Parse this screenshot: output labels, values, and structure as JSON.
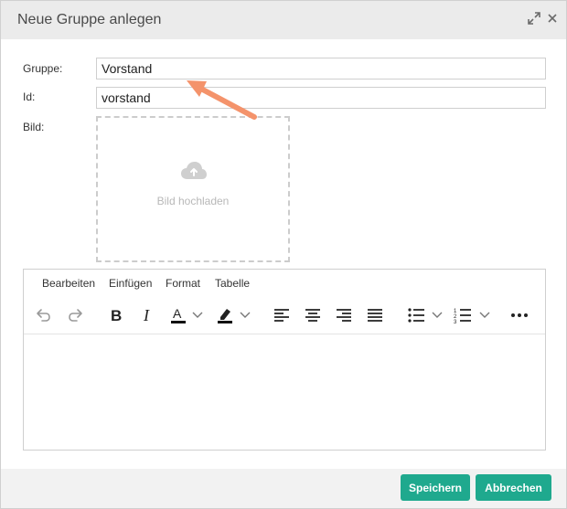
{
  "dialog": {
    "title": "Neue Gruppe anlegen",
    "icons": {
      "maximize": "expand-arrows-icon",
      "close": "close-icon"
    }
  },
  "form": {
    "gruppe": {
      "label": "Gruppe:",
      "value": "Vorstand"
    },
    "id": {
      "label": "Id:",
      "value": "vorstand"
    },
    "bild": {
      "label": "Bild:",
      "upload_text": "Bild hochladen",
      "icon": "cloud-upload-icon"
    }
  },
  "editor": {
    "menu": [
      "Bearbeiten",
      "Einfügen",
      "Format",
      "Tabelle"
    ],
    "toolbar": [
      "undo-icon",
      "redo-icon",
      "bold-icon",
      "italic-icon",
      "text-color-icon",
      "highlight-color-icon",
      "align-left-icon",
      "align-center-icon",
      "align-right-icon",
      "justify-icon",
      "bullet-list-icon",
      "numbered-list-icon",
      "more-icon"
    ],
    "content": ""
  },
  "footer": {
    "save_label": "Speichern",
    "cancel_label": "Abbrechen"
  },
  "colors": {
    "accent": "#1fa98e",
    "arrow": "#f4936b",
    "titlebar": "#ebebeb",
    "footer": "#f2f2f2"
  }
}
